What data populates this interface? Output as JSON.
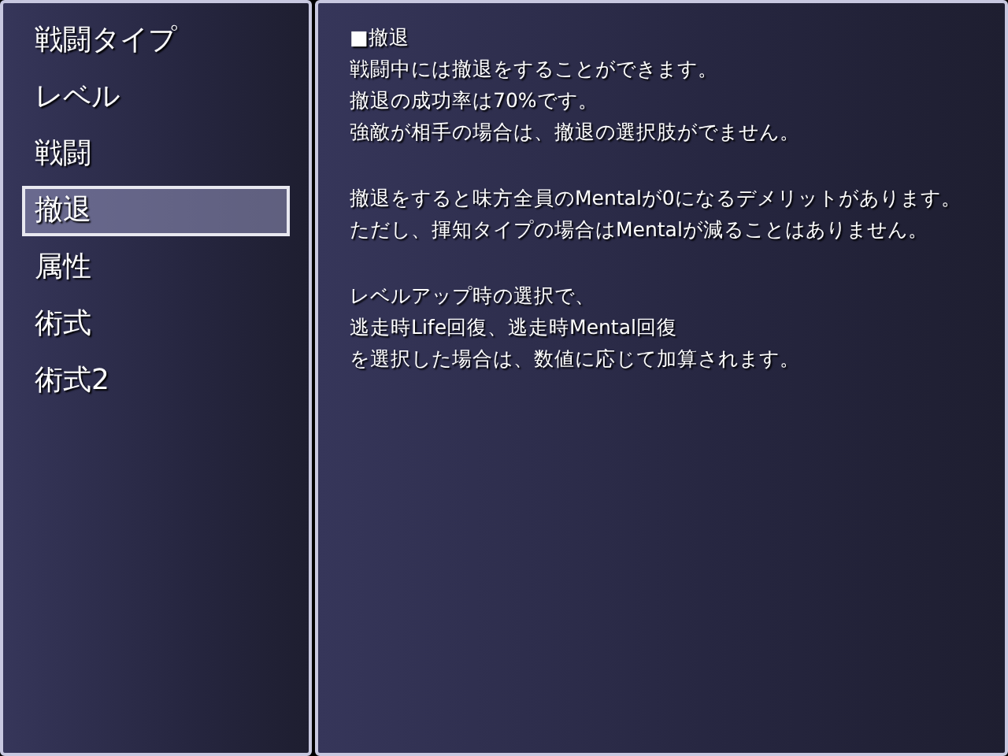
{
  "menu": {
    "items": [
      {
        "label": "戦闘タイプ",
        "selected": false
      },
      {
        "label": "レベル",
        "selected": false
      },
      {
        "label": "戦闘",
        "selected": false
      },
      {
        "label": "撤退",
        "selected": true
      },
      {
        "label": "属性",
        "selected": false
      },
      {
        "label": "術式",
        "selected": false
      },
      {
        "label": "術式2",
        "selected": false
      }
    ]
  },
  "help": {
    "paragraphs": [
      [
        "■撤退",
        "戦闘中には撤退をすることができます。",
        "撤退の成功率は70%です。",
        "強敵が相手の場合は、撤退の選択肢がでません。"
      ],
      [
        "撤退をすると味方全員のMentalが0になるデメリットがあります。",
        "ただし、揮知タイプの場合はMentalが減ることはありません。"
      ],
      [
        "レベルアップ時の選択で、",
        "逃走時Life回復、逃走時Mental回復",
        "を選択した場合は、数値に応じて加算されます。"
      ]
    ]
  }
}
